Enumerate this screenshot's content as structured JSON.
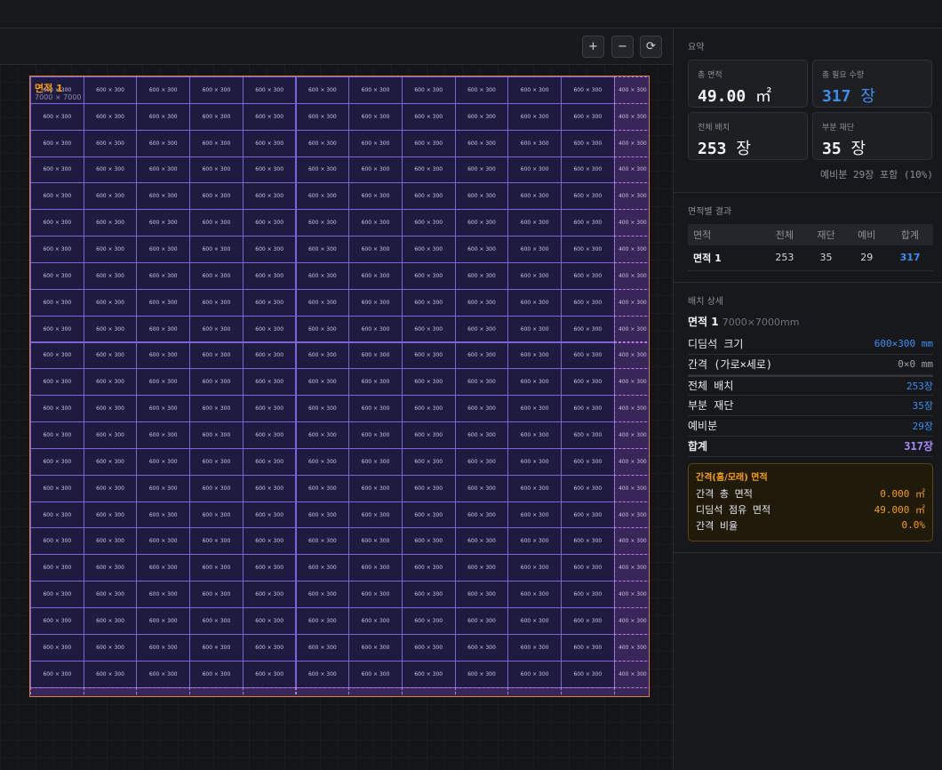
{
  "toolbar": {
    "zoom_in": "+",
    "zoom_out": "−",
    "reset": "⟳"
  },
  "plan": {
    "area_label": "면적 1",
    "area_dims": "7000 × 7000",
    "tile_label": "600 × 300",
    "cut_tile_label": "400 × 300",
    "cols_full": 11,
    "rows_full": 23
  },
  "summary": {
    "title": "요약",
    "total_area_label": "총 면적",
    "total_area_value": "49.00",
    "total_area_unit": "㎡",
    "total_qty_label": "총 필요 수량",
    "total_qty_value": "317",
    "total_qty_unit": "장",
    "full_label": "전체 배치",
    "full_value": "253",
    "full_unit": "장",
    "cut_label": "부분 재단",
    "cut_value": "35",
    "cut_unit": "장",
    "note": "예비분 29장 포함 (10%)"
  },
  "results": {
    "title": "면적별 결과",
    "headers": [
      "면적",
      "전체",
      "재단",
      "예비",
      "합계"
    ],
    "rows": [
      {
        "name": "면적 1",
        "full": "253",
        "cut": "35",
        "spare": "29",
        "total": "317"
      }
    ]
  },
  "detail": {
    "title": "배치 상세",
    "area_name": "면적 1",
    "area_size": "7000×7000mm",
    "tile_size_label": "디딤석 크기",
    "tile_size_value": "600×300 mm",
    "gap_label": "간격 (가로×세로)",
    "gap_value": "0×0 mm",
    "full_label": "전체 배치",
    "full_value": "253장",
    "cut_label": "부분 재단",
    "cut_value": "35장",
    "spare_label": "예비분",
    "spare_value": "29장",
    "sum_label": "합계",
    "sum_value": "317장"
  },
  "grout": {
    "title": "간격(홈/모래) 면적",
    "total_label": "간격 총 면적",
    "total_value": "0.000 ㎡",
    "tile_area_label": "디딤석 점유 면적",
    "tile_area_value": "49.000 ㎡",
    "ratio_label": "간격 비율",
    "ratio_value": "0.0%"
  },
  "colors": {
    "accent": "#3b8ef0",
    "sum": "#a78bfa",
    "warn": "#f59e0b",
    "tile_border": "#7e63d8",
    "plan_border": "#d9803a"
  }
}
